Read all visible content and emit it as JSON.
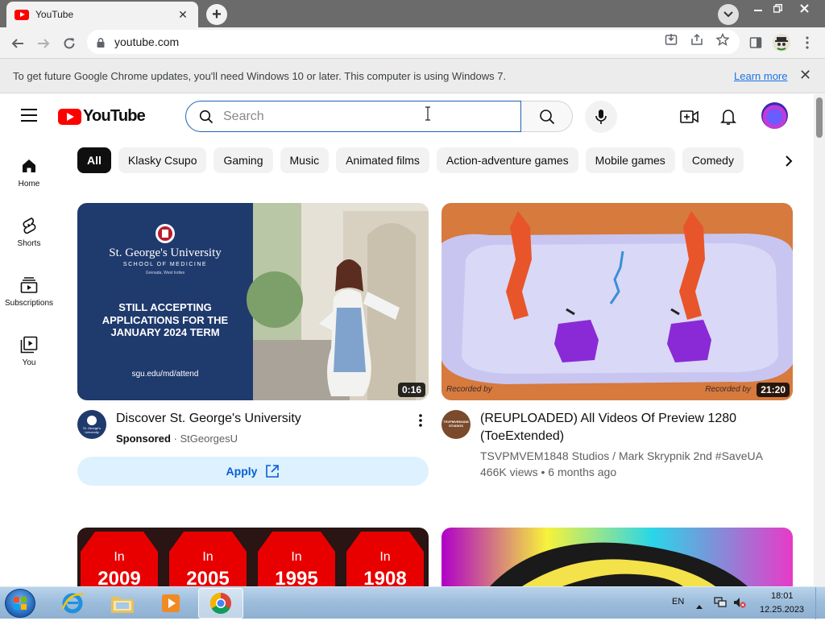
{
  "browser": {
    "tab_title": "YouTube",
    "tab_close": "✕",
    "new_tab": "+",
    "url": "youtube.com",
    "infobar_message": "To get future Google Chrome updates, you'll need Windows 10 or later. This computer is using Windows 7.",
    "infobar_link": "Learn more",
    "infobar_close": "✕"
  },
  "yt": {
    "logo_text": "YouTube",
    "search_placeholder": "Search"
  },
  "guide": [
    {
      "label": "Home",
      "icon": "home-icon"
    },
    {
      "label": "Shorts",
      "icon": "shorts-icon"
    },
    {
      "label": "Subscriptions",
      "icon": "subscriptions-icon"
    },
    {
      "label": "You",
      "icon": "you-icon"
    }
  ],
  "chips": [
    "All",
    "Klasky Csupo",
    "Gaming",
    "Music",
    "Animated films",
    "Action-adventure games",
    "Mobile games",
    "Comedy"
  ],
  "videos": [
    {
      "title": "Discover St. George's University",
      "sponsored": "Sponsored",
      "sep": "·",
      "channel": "StGeorgesU",
      "duration": "0:16",
      "apply": "Apply",
      "ad": {
        "uni_name": "St. George's University",
        "school": "SCHOOL OF MEDICINE",
        "place": "Grenada, West Indies",
        "headline": "STILL ACCEPTING APPLICATIONS FOR THE JANUARY 2024 TERM",
        "url": "sgu.edu/md/attend",
        "avatar_text": "St. George's University"
      }
    },
    {
      "title_line1": "(REUPLOADED) All Videos Of Preview 1280",
      "title_line2": "(ToeExtended)",
      "channel": "TSVPMVEM1848 Studios / Mark Skrypnik 2nd #SaveUA",
      "views": "466K views • 6 months ago",
      "duration": "21:20",
      "watermark_left": "Recorded by",
      "watermark_right": "Recorded by",
      "avatar_text": "TSVPMVEM1848 STUDIOS"
    }
  ],
  "third_thumb": {
    "years": [
      {
        "prefix": "In",
        "year": "2009"
      },
      {
        "prefix": "In",
        "year": "2005"
      },
      {
        "prefix": "In",
        "year": "1995"
      },
      {
        "prefix": "In",
        "year": "1908"
      }
    ]
  },
  "taskbar": {
    "lang": "EN",
    "time": "18:01",
    "date": "12.25.2023"
  },
  "colors": {
    "yt_red": "#ff0000",
    "link_blue": "#065fd4",
    "chip_active": "#0f0f0f",
    "ad_navy": "#1f3a6d"
  }
}
